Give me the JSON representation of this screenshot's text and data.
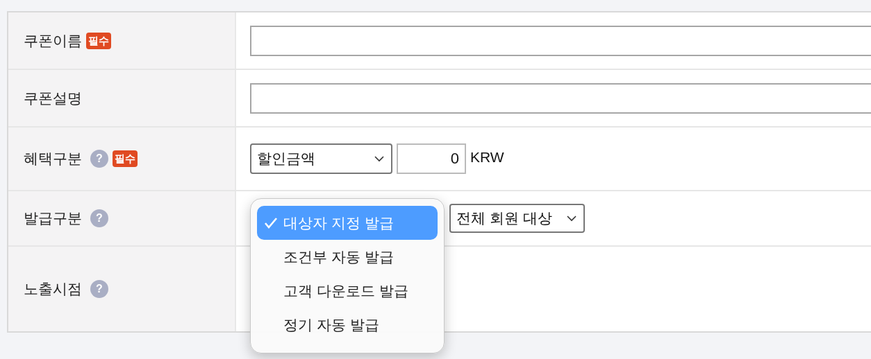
{
  "rows": [
    {
      "label": "쿠폰이름",
      "badge": "필수",
      "kind": "text"
    },
    {
      "label": "쿠폰설명",
      "kind": "text"
    },
    {
      "label": "혜택구분",
      "help_icon": "?",
      "badge": "필수",
      "kind": "amount",
      "select": "할인금액",
      "amount": "0",
      "unit": "KRW"
    },
    {
      "label": "발급구분",
      "help_icon": "?",
      "kind": "issue",
      "target_select": "전체 회원 대상",
      "menu": [
        {
          "label": "대상자 지정 발급",
          "selected": true
        },
        {
          "label": "조건부 자동 발급",
          "selected": false
        },
        {
          "label": "고객 다운로드 발급",
          "selected": false
        },
        {
          "label": "정기 자동 발급",
          "selected": false
        }
      ]
    },
    {
      "label": "노출시점",
      "help_icon": "?",
      "kind": "empty"
    }
  ]
}
